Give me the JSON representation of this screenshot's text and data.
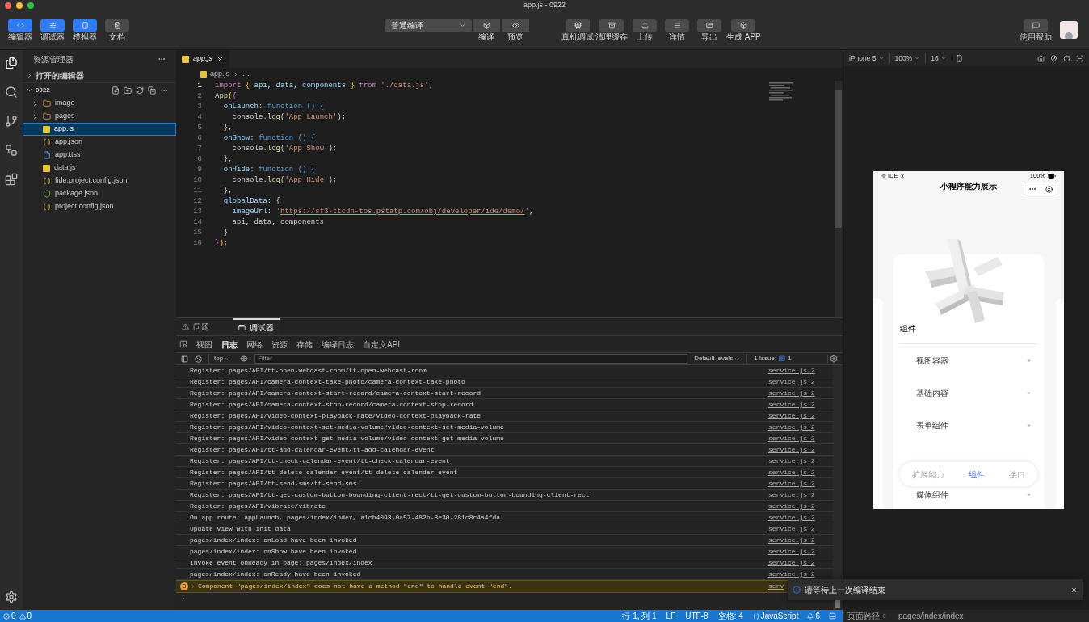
{
  "window": {
    "title": "app.js - 0922"
  },
  "toolbar": {
    "view_toggles": [
      {
        "label": "编辑器",
        "selected": true
      },
      {
        "label": "调试器",
        "selected": true
      },
      {
        "label": "模拟器",
        "selected": true
      },
      {
        "label": "文档",
        "selected": false
      }
    ],
    "compile_mode": "普通编译",
    "compile_actions": [
      "编译",
      "预览"
    ],
    "actions": [
      "真机调试",
      "清理缓存",
      "上传",
      "详情",
      "导出",
      "生成 APP"
    ],
    "help": "使用帮助"
  },
  "sidebar": {
    "title": "资源管理器",
    "open_editors": {
      "label": "打开的编辑器",
      "expanded": false
    },
    "project": {
      "label": "0922",
      "expanded": true,
      "children": [
        {
          "name": "image",
          "kind": "folder",
          "expanded": false,
          "selected": false
        },
        {
          "name": "pages",
          "kind": "folder",
          "expanded": false,
          "selected": false
        },
        {
          "name": "app.js",
          "kind": "js",
          "selected": true
        },
        {
          "name": "app.json",
          "kind": "json",
          "selected": false
        },
        {
          "name": "app.ttss",
          "kind": "file",
          "selected": false
        },
        {
          "name": "data.js",
          "kind": "js",
          "selected": false
        },
        {
          "name": "fide.project.config.json",
          "kind": "json",
          "selected": false
        },
        {
          "name": "package.json",
          "kind": "node",
          "selected": false
        },
        {
          "name": "project.config.json",
          "kind": "json",
          "selected": false
        }
      ]
    }
  },
  "editor": {
    "tabs": [
      {
        "label": "app.js",
        "selected": true
      }
    ],
    "breadcrumb": [
      "app.js",
      "…"
    ],
    "lines": [
      {
        "number": "1",
        "current": true,
        "tokens": [
          {
            "kind": "keyword",
            "text": "import "
          },
          {
            "kind": "bracket",
            "text": "{"
          },
          {
            "kind": "var",
            "text": " api, data, components "
          },
          {
            "kind": "bracket",
            "text": "}"
          },
          {
            "kind": "keyword",
            "text": " from "
          },
          {
            "kind": "string",
            "text": "'./data.js'"
          },
          {
            "kind": "plain",
            "text": ";"
          }
        ]
      },
      {
        "number": "2",
        "current": false,
        "tokens": [
          {
            "kind": "fn",
            "text": "App"
          },
          {
            "kind": "bracket",
            "text": "("
          },
          {
            "kind": "bracket2",
            "text": "{"
          }
        ]
      },
      {
        "number": "3",
        "current": false,
        "tokens": [
          {
            "kind": "prop",
            "text": "  onLaunch"
          },
          {
            "kind": "plain",
            "text": ": "
          },
          {
            "kind": "storage",
            "text": "function () {"
          }
        ]
      },
      {
        "number": "4",
        "current": false,
        "tokens": [
          {
            "kind": "plain",
            "text": "    console."
          },
          {
            "kind": "fn",
            "text": "log"
          },
          {
            "kind": "plain",
            "text": "("
          },
          {
            "kind": "string",
            "text": "'App Launch'"
          },
          {
            "kind": "plain",
            "text": ");"
          }
        ]
      },
      {
        "number": "5",
        "current": false,
        "tokens": [
          {
            "kind": "plain",
            "text": "  },"
          }
        ]
      },
      {
        "number": "6",
        "current": false,
        "tokens": [
          {
            "kind": "prop",
            "text": "  onShow"
          },
          {
            "kind": "plain",
            "text": ": "
          },
          {
            "kind": "storage",
            "text": "function () {"
          }
        ]
      },
      {
        "number": "7",
        "current": false,
        "tokens": [
          {
            "kind": "plain",
            "text": "    console."
          },
          {
            "kind": "fn",
            "text": "log"
          },
          {
            "kind": "plain",
            "text": "("
          },
          {
            "kind": "string",
            "text": "'App Show'"
          },
          {
            "kind": "plain",
            "text": ");"
          }
        ]
      },
      {
        "number": "8",
        "current": false,
        "tokens": [
          {
            "kind": "plain",
            "text": "  },"
          }
        ]
      },
      {
        "number": "9",
        "current": false,
        "tokens": [
          {
            "kind": "prop",
            "text": "  onHide"
          },
          {
            "kind": "plain",
            "text": ": "
          },
          {
            "kind": "storage",
            "text": "function () {"
          }
        ]
      },
      {
        "number": "10",
        "current": false,
        "tokens": [
          {
            "kind": "plain",
            "text": "    console."
          },
          {
            "kind": "fn",
            "text": "log"
          },
          {
            "kind": "plain",
            "text": "("
          },
          {
            "kind": "string",
            "text": "'App Hide'"
          },
          {
            "kind": "plain",
            "text": ");"
          }
        ]
      },
      {
        "number": "11",
        "current": false,
        "tokens": [
          {
            "kind": "plain",
            "text": "  },"
          }
        ]
      },
      {
        "number": "12",
        "current": false,
        "tokens": [
          {
            "kind": "prop",
            "text": "  globalData"
          },
          {
            "kind": "plain",
            "text": ": {"
          }
        ]
      },
      {
        "number": "13",
        "current": false,
        "tokens": [
          {
            "kind": "prop",
            "text": "    imageUrl"
          },
          {
            "kind": "plain",
            "text": ": "
          },
          {
            "kind": "string",
            "text": "'"
          },
          {
            "kind": "url",
            "text": "https://sf3-ttcdn-tos.pstatp.com/obj/developer/ide/demo/"
          },
          {
            "kind": "string",
            "text": "'"
          },
          {
            "kind": "plain",
            "text": ","
          }
        ]
      },
      {
        "number": "14",
        "current": false,
        "tokens": [
          {
            "kind": "plain",
            "text": "    api, data, components"
          }
        ]
      },
      {
        "number": "15",
        "current": false,
        "tokens": [
          {
            "kind": "plain",
            "text": "  }"
          }
        ]
      },
      {
        "number": "16",
        "current": false,
        "tokens": [
          {
            "kind": "bracket2",
            "text": "}"
          },
          {
            "kind": "bracket",
            "text": ")"
          },
          {
            "kind": "plain",
            "text": ";"
          }
        ]
      }
    ]
  },
  "panel": {
    "tabs": [
      {
        "label": "问题",
        "selected": false
      },
      {
        "label": "调试器",
        "selected": true
      }
    ],
    "subtabs": [
      {
        "label": "视图",
        "selected": false
      },
      {
        "label": "日志",
        "selected": true
      },
      {
        "label": "网络",
        "selected": false
      },
      {
        "label": "资源",
        "selected": false
      },
      {
        "label": "存储",
        "selected": false
      },
      {
        "label": "编译日志",
        "selected": false
      },
      {
        "label": "自定义API",
        "selected": false
      }
    ],
    "context": "top",
    "filter_placeholder": "Filter",
    "levels": "Default levels",
    "issues": "1 Issue:",
    "issue_count": "1",
    "logs": [
      {
        "text": "Register: pages/API/tt-open-webcast-room/tt-open-webcast-room",
        "source": "service.js:2"
      },
      {
        "text": "Register: pages/API/camera-context-take-photo/camera-context-take-photo",
        "source": "service.js:2"
      },
      {
        "text": "Register: pages/API/camera-context-start-record/camera-context-start-record",
        "source": "service.js:2"
      },
      {
        "text": "Register: pages/API/camera-context-stop-record/camera-context-stop-record",
        "source": "service.js:2"
      },
      {
        "text": "Register: pages/API/video-context-playback-rate/video-context-playback-rate",
        "source": "service.js:2"
      },
      {
        "text": "Register: pages/API/video-context-set-media-volume/video-context-set-media-volume",
        "source": "service.js:2"
      },
      {
        "text": "Register: pages/API/video-context-get-media-volume/video-context-get-media-volume",
        "source": "service.js:2"
      },
      {
        "text": "Register: pages/API/tt-add-calendar-event/tt-add-calendar-event",
        "source": "service.js:2"
      },
      {
        "text": "Register: pages/API/tt-check-calendar-event/tt-check-calendar-event",
        "source": "service.js:2"
      },
      {
        "text": "Register: pages/API/tt-delete-calendar-event/tt-delete-calendar-event",
        "source": "service.js:2"
      },
      {
        "text": "Register: pages/API/tt-send-sms/tt-send-sms",
        "source": "service.js:2"
      },
      {
        "text": "Register: pages/API/tt-get-custom-button-bounding-client-rect/tt-get-custom-button-bounding-client-rect",
        "source": "service.js:2"
      },
      {
        "text": "Register: pages/API/vibrate/vibrate",
        "source": "service.js:2"
      },
      {
        "text": "On app route: appLaunch, pages/index/index, a1cb4093-0a57-482b-8e30-281c8c4a4fda",
        "source": "service.js:2"
      },
      {
        "text": "Update view with init data",
        "source": "service.js:2"
      },
      {
        "text": "pages/index/index: onLoad have been invoked",
        "source": "service.js:2"
      },
      {
        "text": "pages/index/index: onShow have been invoked",
        "source": "service.js:2"
      },
      {
        "text": "Invoke event onReady in page: pages/index/index",
        "source": "service.js:2"
      },
      {
        "text": "pages/index/index: onReady have been invoked",
        "source": "service.js:2"
      }
    ],
    "warning": {
      "count": "3",
      "text": "Component \"pages/index/index\" does not have a method \"end\" to handle event \"end\".",
      "source": "serv"
    }
  },
  "status_bar": {
    "errors": "0",
    "warnings": "0",
    "items": [
      "行 1, 列 1",
      "LF",
      "UTF-8",
      "空格: 4",
      "JavaScript"
    ],
    "notifications": "6"
  },
  "simulator": {
    "device": "iPhone 5",
    "zoom": "100%",
    "font_size": "16",
    "phone": {
      "carrier": "IDE",
      "battery": "100%",
      "title": "小程序能力展示",
      "section": "组件",
      "items": [
        "视图容器",
        "基础内容",
        "表单组件",
        "媒体组件"
      ],
      "tabbar": [
        {
          "label": "扩展能力",
          "selected": false
        },
        {
          "label": "组件",
          "selected": true
        },
        {
          "label": "接口",
          "selected": false
        }
      ]
    },
    "path_label": "页面路径",
    "path": "pages/index/index"
  },
  "toast": {
    "text": "请等待上一次编译结束"
  }
}
